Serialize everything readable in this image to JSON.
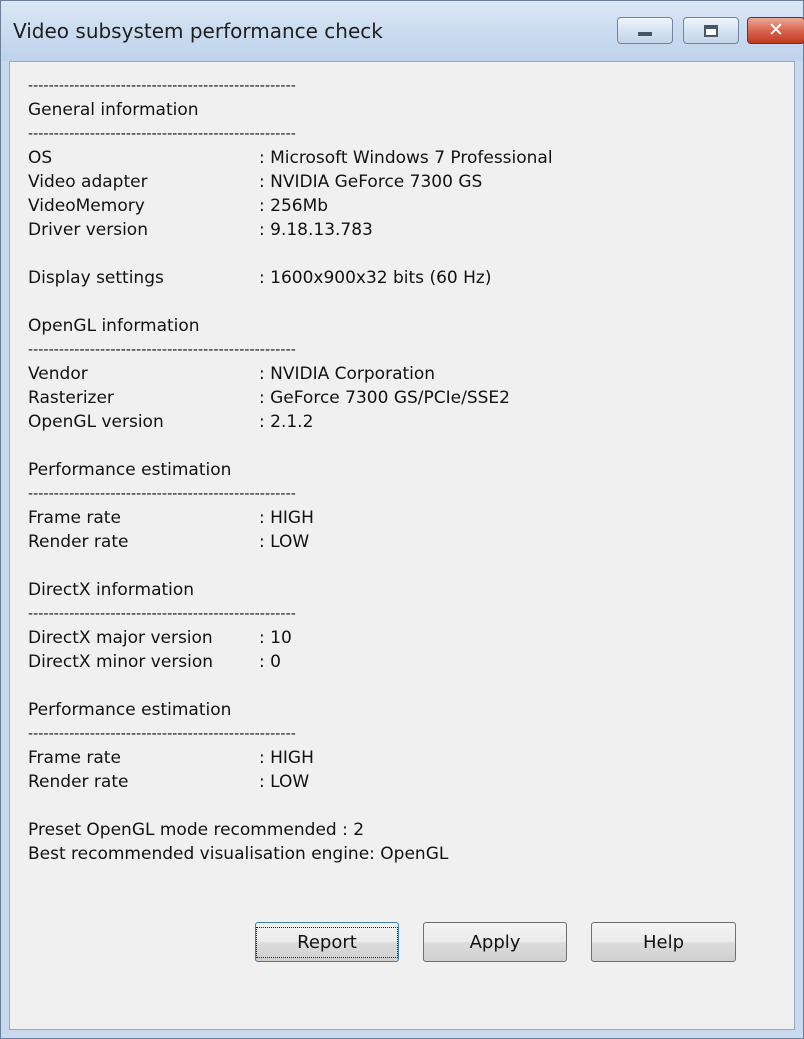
{
  "window": {
    "title": "Video subsystem performance check",
    "minimize_icon": "minimize-icon",
    "maximize_icon": "maximize-icon",
    "close_icon": "close-icon",
    "close_glyph": "✕"
  },
  "dashes": "----------------------------------------------------",
  "general": {
    "header": "General information",
    "rows": [
      {
        "key": "OS",
        "value": ": Microsoft Windows 7 Professional"
      },
      {
        "key": "Video adapter",
        "value": ": NVIDIA GeForce 7300 GS"
      },
      {
        "key": "VideoMemory",
        "value": ": 256Mb"
      },
      {
        "key": "Driver version",
        "value": ": 9.18.13.783"
      }
    ],
    "display": {
      "key": "Display settings",
      "value": ": 1600x900x32 bits (60 Hz)"
    }
  },
  "opengl": {
    "header": "OpenGL information",
    "rows": [
      {
        "key": "Vendor",
        "value": ": NVIDIA Corporation"
      },
      {
        "key": "Rasterizer",
        "value": ": GeForce 7300 GS/PCIe/SSE2"
      },
      {
        "key": "OpenGL version",
        "value": ": 2.1.2"
      }
    ],
    "perf_header": "Performance estimation",
    "perf_rows": [
      {
        "key": "Frame rate",
        "value": ": HIGH"
      },
      {
        "key": "Render rate",
        "value": ": LOW"
      }
    ]
  },
  "directx": {
    "header": "DirectX information",
    "rows": [
      {
        "key": "DirectX major version",
        "value": ": 10"
      },
      {
        "key": "DirectX minor version",
        "value": ": 0"
      }
    ],
    "perf_header": "Performance estimation",
    "perf_rows": [
      {
        "key": "Frame rate",
        "value": ": HIGH"
      },
      {
        "key": "Render rate",
        "value": ": LOW"
      }
    ]
  },
  "summary": {
    "preset": "Preset OpenGL mode recommended : 2",
    "engine": "Best recommended visualisation engine: OpenGL"
  },
  "buttons": {
    "report": "Report",
    "apply": "Apply",
    "help": "Help"
  }
}
